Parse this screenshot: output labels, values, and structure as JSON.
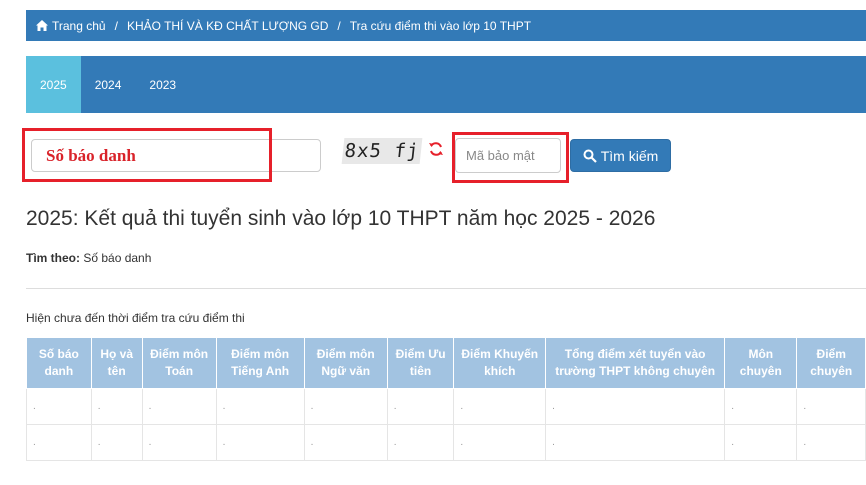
{
  "breadcrumb": {
    "home": "Trang chủ",
    "items": [
      "KHẢO THÍ VÀ KĐ CHẤT LƯỢNG GD",
      "Tra cứu điểm thi vào lớp 10 THPT"
    ]
  },
  "years": [
    {
      "label": "2025",
      "active": true
    },
    {
      "label": "2024",
      "active": false
    },
    {
      "label": "2023",
      "active": false
    }
  ],
  "search": {
    "sbd_value": "Số báo danh",
    "captcha_text": "8x5 fj",
    "security_placeholder": "Mã bảo mật",
    "button_label": "Tìm kiếm"
  },
  "result": {
    "title": "2025: Kết quả thi tuyển sinh vào lớp 10 THPT năm học 2025 - 2026",
    "filter_label": "Tìm theo:",
    "filter_value": "Số báo danh",
    "notice": "Hiện chưa đến thời điểm tra cứu điểm thi"
  },
  "table": {
    "headers": [
      "Số báo danh",
      "Họ và tên",
      "Điểm môn Toán",
      "Điểm môn Tiếng Anh",
      "Điểm môn Ngữ văn",
      "Điểm Ưu tiên",
      "Điểm Khuyến khích",
      "Tổng điểm xét tuyển vào trường THPT không chuyên",
      "Môn chuyên",
      "Điểm chuyên"
    ],
    "rows": [
      [
        ".",
        ".",
        ".",
        ".",
        ".",
        ".",
        ".",
        ".",
        ".",
        "."
      ],
      [
        ".",
        ".",
        ".",
        ".",
        ".",
        ".",
        ".",
        ".",
        ".",
        "."
      ]
    ]
  },
  "colors": {
    "primary": "#337ab7",
    "active_tab": "#5bc0de",
    "table_header": "#a2c3e1",
    "highlight": "#e6202a"
  }
}
